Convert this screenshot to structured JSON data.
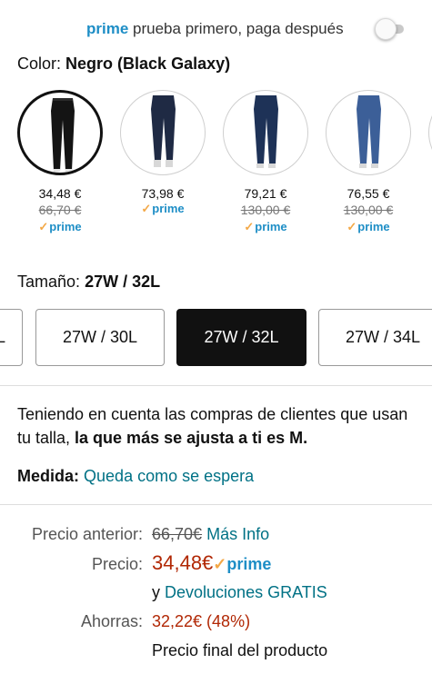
{
  "prime_banner": {
    "prime_word": "prime",
    "text": "prueba primero, paga después",
    "toggle_on": false
  },
  "color": {
    "label": "Color:",
    "value": "Negro (Black Galaxy)"
  },
  "swatches": [
    {
      "price": "34,48 €",
      "old_price": "66,70 €",
      "prime": "prime",
      "color": "#141414",
      "selected": true
    },
    {
      "price": "73,98 €",
      "old_price": "",
      "prime": "prime",
      "color": "#1f2a44",
      "selected": false
    },
    {
      "price": "79,21 €",
      "old_price": "130,00 €",
      "prime": "prime",
      "color": "#1e3257",
      "selected": false
    },
    {
      "price": "76,55 €",
      "old_price": "130,00 €",
      "prime": "prime",
      "color": "#3c5f98",
      "selected": false
    }
  ],
  "size": {
    "label": "Tamaño:",
    "value": "27W / 32L",
    "options": [
      "L",
      "27W / 30L",
      "27W / 32L",
      "27W / 34L"
    ]
  },
  "fit": {
    "text": "Teniendo en cuenta las compras de clientes que usan tu talla, ",
    "bold": "la que más se ajusta a ti es M."
  },
  "medida": {
    "label": "Medida:",
    "value": "Queda como se espera"
  },
  "pricing": {
    "previous_label": "Precio anterior:",
    "previous_value": "66,70€",
    "more_info": "Más Info",
    "price_label": "Precio:",
    "price_value": "34,48€",
    "prime": "prime",
    "returns_prefix": "y",
    "returns_link": "Devoluciones GRATIS",
    "savings_label": "Ahorras:",
    "savings_value": "32,22€ (48%)",
    "final_note": "Precio final del producto"
  },
  "colors": {
    "prime_blue": "#1e8ec6",
    "link_teal": "#007185",
    "price_red": "#b12704",
    "check_orange": "#f3a847"
  }
}
